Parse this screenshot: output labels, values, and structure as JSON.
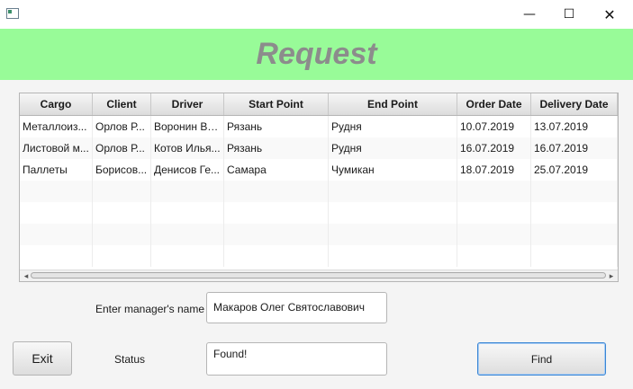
{
  "window": {
    "min_symbol": "—",
    "max_symbol": "☐",
    "close_symbol": "✕"
  },
  "banner": {
    "title": "Request",
    "color": "#98fb98"
  },
  "table": {
    "columns": [
      "Cargo",
      "Client",
      "Driver",
      "Start Point",
      "End Point",
      "Order Date",
      "Delivery Date"
    ],
    "rows": [
      [
        "Металлоиз...",
        "Орлов Р...",
        "Воронин Вя...",
        "Рязань",
        "Рудня",
        "10.07.2019",
        "13.07.2019"
      ],
      [
        "Листовой м...",
        "Орлов Р...",
        "Котов Илья...",
        "Рязань",
        "Рудня",
        "16.07.2019",
        "16.07.2019"
      ],
      [
        "Паллеты",
        "Борисов...",
        "Денисов Ге...",
        "Самара",
        "Чумикан",
        "18.07.2019",
        "25.07.2019"
      ]
    ],
    "empty_rows": 4
  },
  "form": {
    "manager_label": "Enter manager's name",
    "manager_value": "Макаров Олег Святославович",
    "status_label": "Status",
    "status_value": "Found!"
  },
  "buttons": {
    "exit": "Exit",
    "find": "Find"
  }
}
